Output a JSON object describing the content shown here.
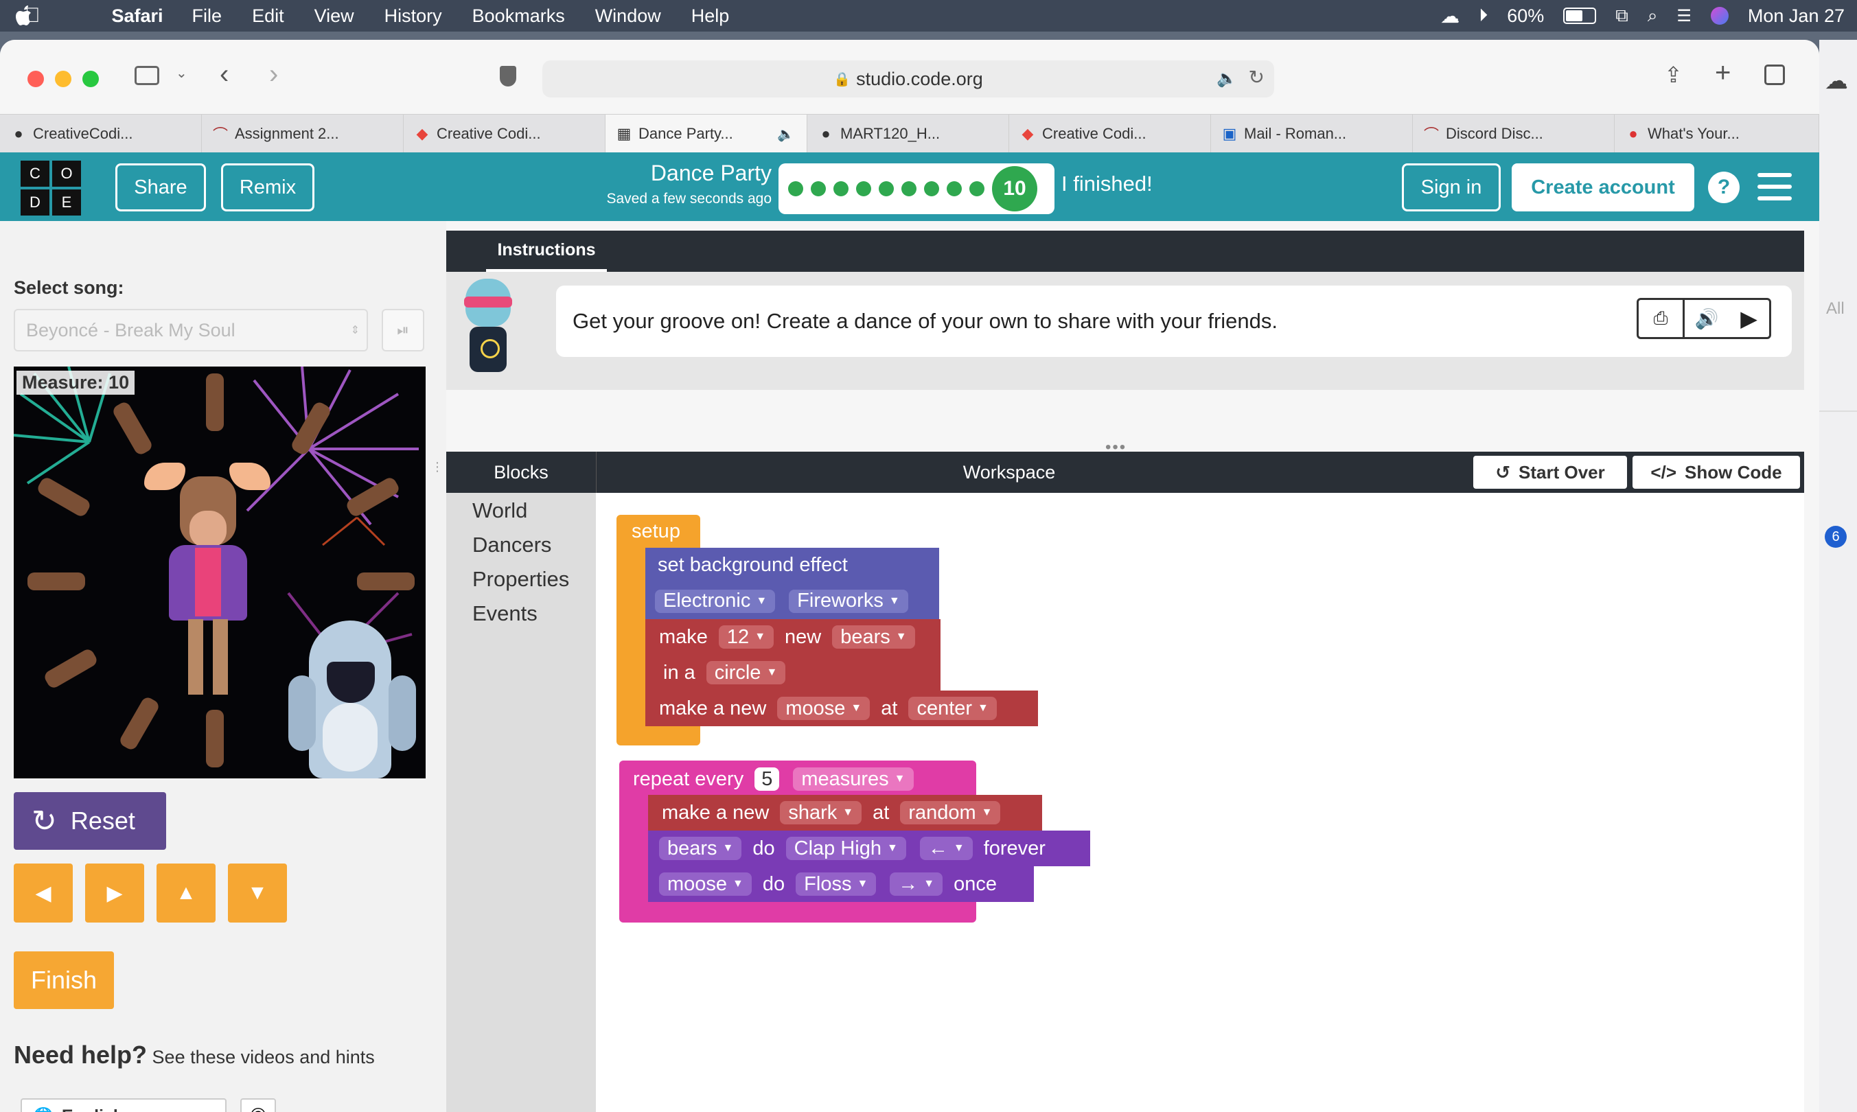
{
  "menubar": {
    "apple": "",
    "app": "Safari",
    "items": [
      "File",
      "Edit",
      "View",
      "History",
      "Bookmarks",
      "Window",
      "Help"
    ],
    "battery": "60%",
    "clock": "Mon Jan 27"
  },
  "browser": {
    "url": "studio.code.org",
    "tabs": [
      {
        "label": "CreativeCodi...",
        "icon": "github-icon"
      },
      {
        "label": "Assignment 2...",
        "icon": "canvas-icon"
      },
      {
        "label": "Creative Codi...",
        "icon": "drive-icon"
      },
      {
        "label": "Dance Party...",
        "icon": "codeorg-icon"
      },
      {
        "label": "MART120_H...",
        "icon": "github-icon"
      },
      {
        "label": "Creative Codi...",
        "icon": "drive-icon"
      },
      {
        "label": "Mail - Roman...",
        "icon": "outlook-icon"
      },
      {
        "label": "Discord Disc...",
        "icon": "canvas-icon"
      },
      {
        "label": "What's Your...",
        "icon": "apple-fruit-icon"
      }
    ]
  },
  "header": {
    "logo": [
      "C",
      "O",
      "D",
      "E"
    ],
    "share": "Share",
    "remix": "Remix",
    "title": "Dance Party",
    "saved": "Saved a few seconds ago",
    "level": "10",
    "finished": "I finished!",
    "signin": "Sign in",
    "create": "Create account",
    "help": "?"
  },
  "left": {
    "select_song": "Select song:",
    "song": "Beyoncé - Break My Soul",
    "measure": "Measure: 10",
    "reset": "Reset",
    "finish": "Finish",
    "need_help": "Need help?",
    "hints": "See these videos and hints",
    "language": "English",
    "copyright": "©"
  },
  "instructions": {
    "tab": "Instructions",
    "text": "Get your groove on! Create a dance of your own to share with your friends."
  },
  "workspace": {
    "blocks_label": "Blocks",
    "title": "Workspace",
    "start_over": "Start Over",
    "show_code": "Show Code",
    "categories": [
      "World",
      "Dancers",
      "Properties",
      "Events"
    ],
    "setup": "setup",
    "set_bg": "set background effect",
    "palette": "Electronic",
    "effect": "Fireworks",
    "make": "make",
    "count": "12",
    "new": "new",
    "bears": "bears",
    "in_a": "in a",
    "circle": "circle",
    "make_a_new": "make a new",
    "moose": "moose",
    "at": "at",
    "center": "center",
    "repeat_every": "repeat every",
    "five": "5",
    "measures": "measures",
    "shark": "shark",
    "random": "random",
    "do": "do",
    "clap": "Clap High",
    "left_arrow": "←",
    "forever": "forever",
    "floss": "Floss",
    "right_arrow": "→",
    "once": "once"
  },
  "side": {
    "all": "All",
    "badge": "6"
  },
  "colors": {
    "teal": "#2799a8",
    "orange": "#f6a733",
    "purple": "#5f4a8f",
    "block_event": "#f5a32c",
    "block_world": "#5b5bb0",
    "block_dancer": "#b23b3f",
    "block_repeat": "#e03ca6",
    "block_move": "#7a3bb5"
  }
}
